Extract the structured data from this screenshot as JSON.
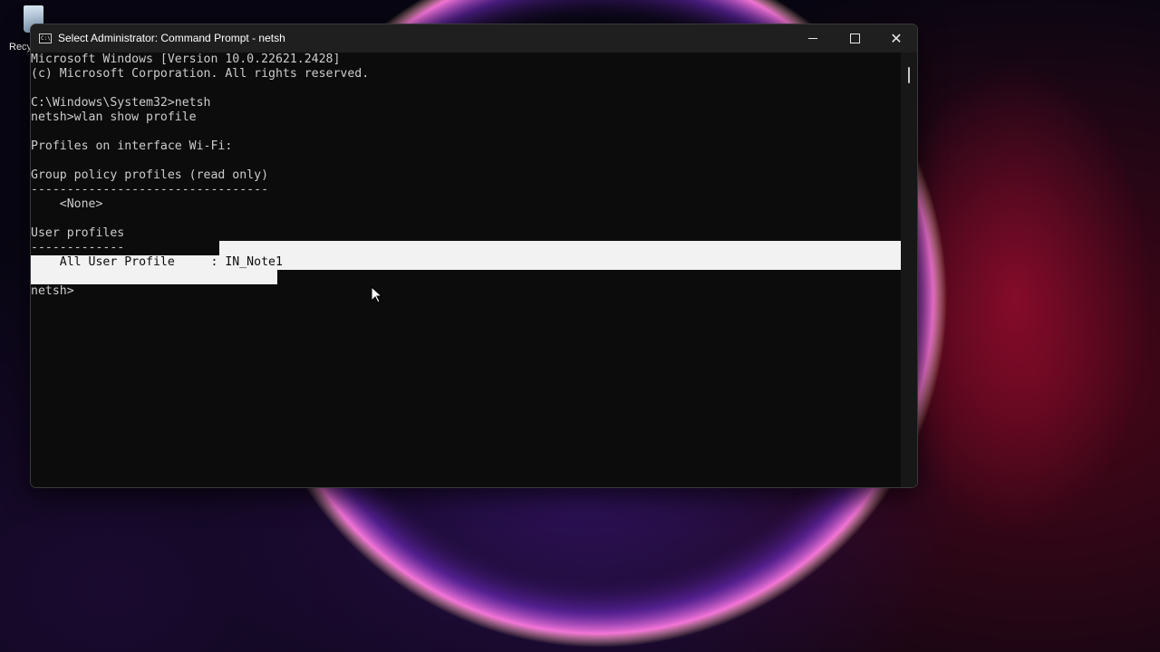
{
  "desktop": {
    "recycle_bin_label": "Recyc"
  },
  "window": {
    "title": "Select Administrator: Command Prompt - netsh",
    "icon": "cmd-icon",
    "controls": {
      "minimize": "minimize-icon",
      "maximize": "maximize-icon",
      "close": "close-icon"
    }
  },
  "console": {
    "lines": [
      "Microsoft Windows [Version 10.0.22621.2428]",
      "(c) Microsoft Corporation. All rights reserved.",
      "",
      "C:\\Windows\\System32>netsh",
      "netsh>wlan show profile",
      "",
      "Profiles on interface Wi-Fi:",
      "",
      "Group policy profiles (read only)",
      "---------------------------------",
      "    <None>",
      "",
      "User profiles",
      "-------------",
      "    All User Profile     : IN_Note1",
      "",
      "netsh>"
    ],
    "selected_line": 14
  },
  "colors": {
    "console_background": "#0c0c0c",
    "console_text": "#cccccc",
    "selection": "#f2f2f2",
    "titlebar": "#1f1f1f"
  }
}
